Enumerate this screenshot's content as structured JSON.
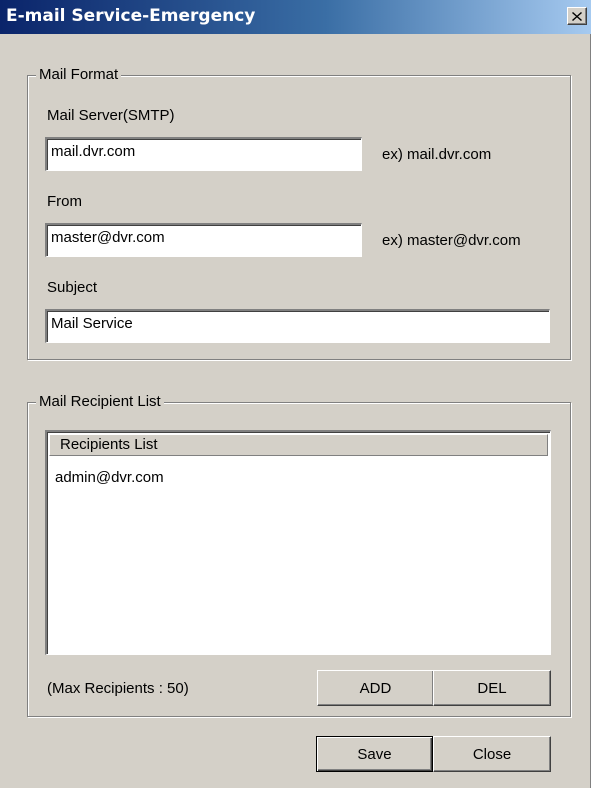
{
  "window": {
    "title": "E-mail Service-Emergency"
  },
  "mail_format": {
    "legend": "Mail Format",
    "server_label": "Mail Server(SMTP)",
    "server_value": "mail.dvr.com",
    "server_example": "ex) mail.dvr.com",
    "from_label": "From",
    "from_value": "master@dvr.com",
    "from_example": "ex) master@dvr.com",
    "subject_label": "Subject",
    "subject_value": "Mail Service"
  },
  "recipients": {
    "legend": "Mail Recipient List",
    "column_header": "Recipients List",
    "items": [
      "admin@dvr.com"
    ],
    "max_label": "(Max Recipients : 50)",
    "add_label": "ADD",
    "del_label": "DEL"
  },
  "footer": {
    "save_label": "Save",
    "close_label": "Close"
  },
  "icons": {
    "close": "close-icon"
  }
}
